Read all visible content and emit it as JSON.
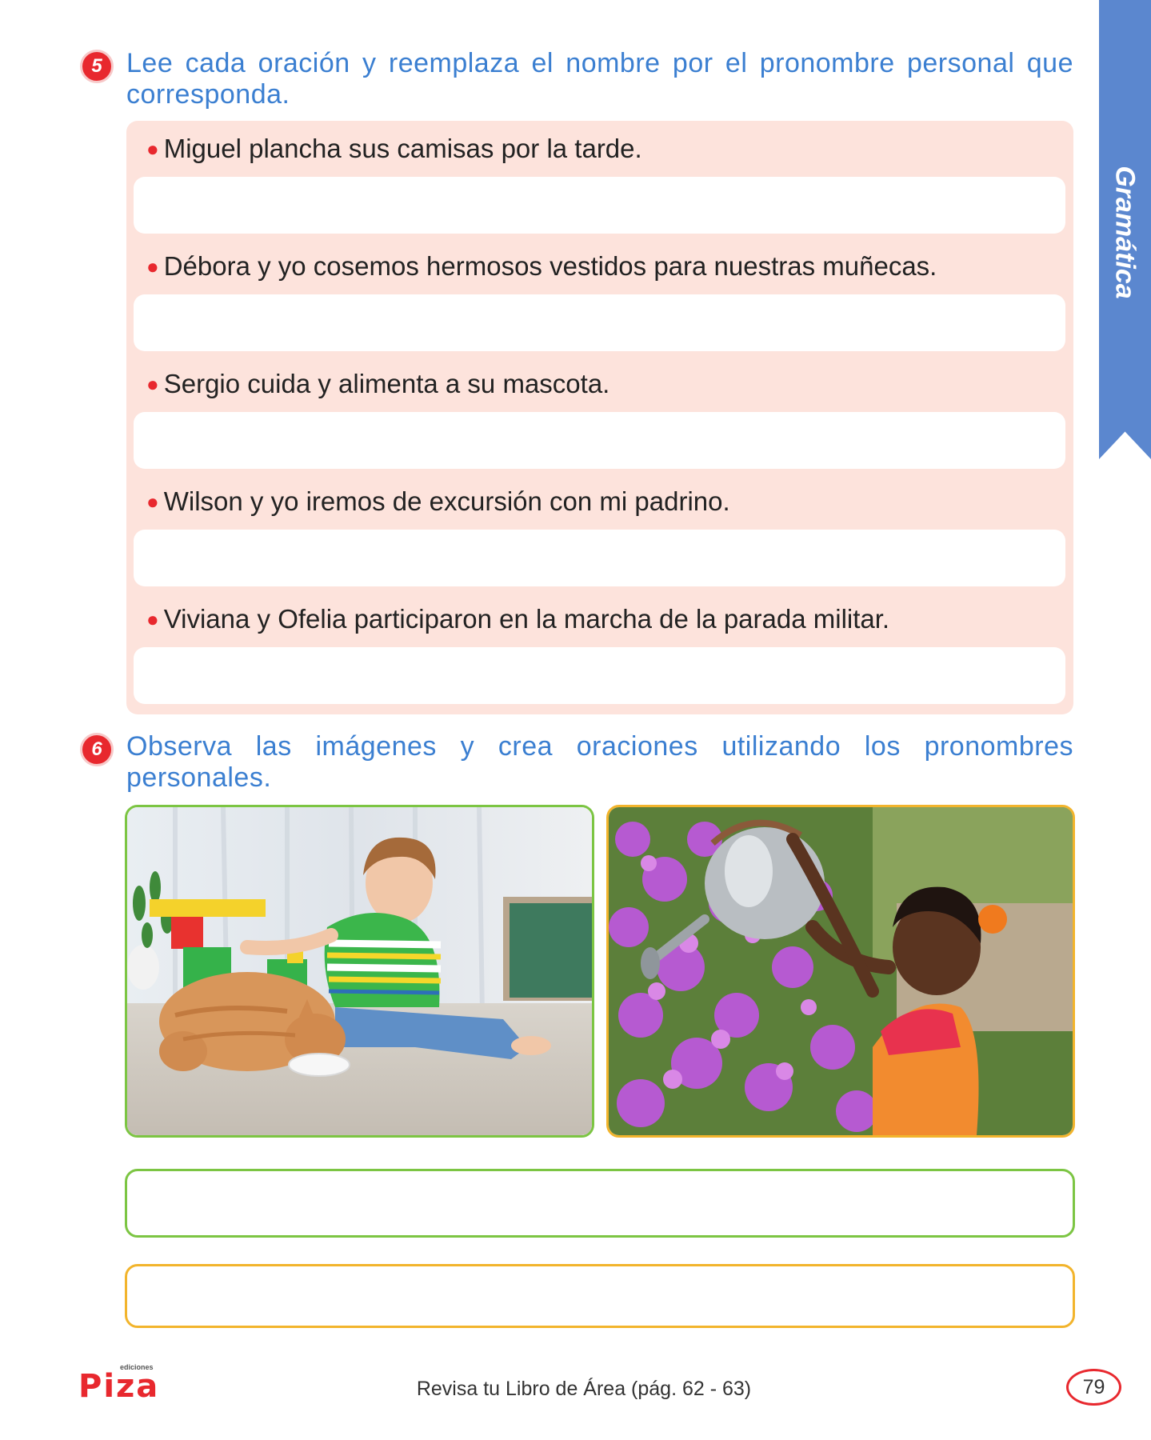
{
  "side_tab": {
    "label": "Gramática"
  },
  "exercise5": {
    "number": "5",
    "instruction": "Lee cada oración y reemplaza el nombre por el pronombre personal que corresponda.",
    "sentences": [
      "Miguel plancha sus camisas por la tarde.",
      "Débora y yo cosemos hermosos vestidos para nuestras muñecas.",
      "Sergio cuida y alimenta a su mascota.",
      "Wilson y yo iremos de excursión con mi padrino.",
      "Viviana y Ofelia participaron en la marcha de la parada militar."
    ]
  },
  "exercise6": {
    "number": "6",
    "instruction": "Observa las imágenes y crea oraciones utilizando los pronombres personales."
  },
  "colors": {
    "accent_blue": "#3b7fd1",
    "red": "#e8282e",
    "panel_pink": "#fde3dc",
    "green": "#7cc543",
    "orange": "#f2b42c",
    "tab_blue": "#5b87cf"
  },
  "footer": {
    "logo_text": "Piza",
    "logo_sub": "ediciones",
    "note": "Revisa tu Libro de Área (pág. 62 - 63)",
    "page_number": "79"
  }
}
